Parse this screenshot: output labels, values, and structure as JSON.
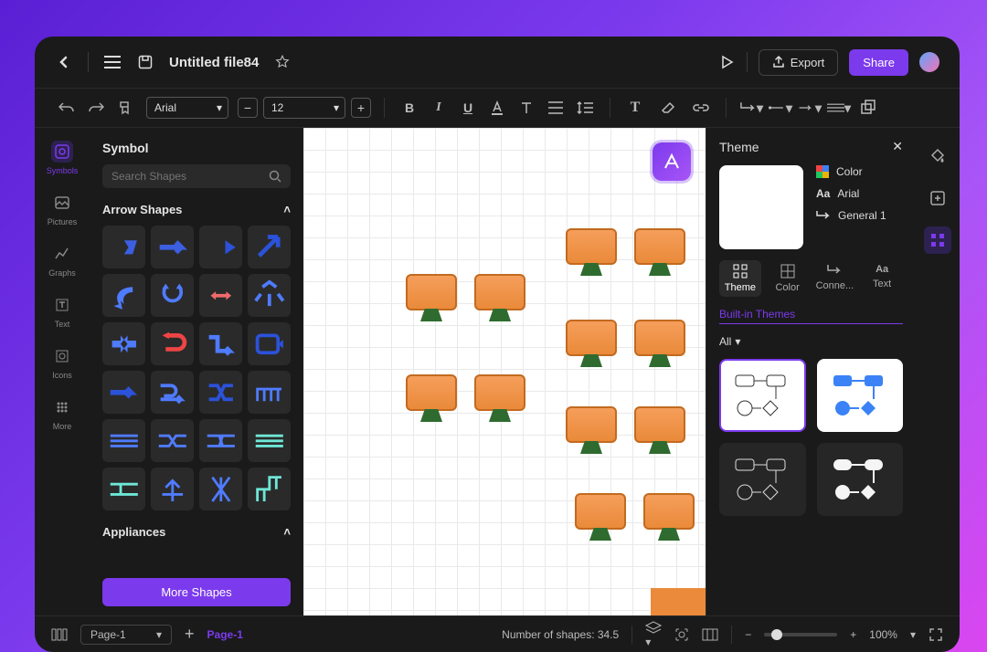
{
  "titlebar": {
    "filename": "Untitled file84",
    "play_label": "Play",
    "export_label": "Export",
    "share_label": "Share"
  },
  "toolbar": {
    "font": "Arial",
    "font_size": "12"
  },
  "left_rail": {
    "items": [
      {
        "label": "Symbols",
        "active": true
      },
      {
        "label": "Pictures"
      },
      {
        "label": "Graphs"
      },
      {
        "label": "Text"
      },
      {
        "label": "Icons"
      },
      {
        "label": "More"
      }
    ]
  },
  "left_panel": {
    "title": "Symbol",
    "search_placeholder": "Search Shapes",
    "section1": "Arrow Shapes",
    "section2": "Appliances",
    "more_label": "More Shapes"
  },
  "right_panel": {
    "title": "Theme",
    "meta_color": "Color",
    "meta_font": "Arial",
    "meta_conn": "General 1",
    "tabs": [
      "Theme",
      "Color",
      "Conne...",
      "Text"
    ],
    "builtin": "Built-in Themes",
    "filter": "All"
  },
  "statusbar": {
    "page_sel": "Page-1",
    "page_active": "Page-1",
    "shapes_label": "Number of shapes: 34.5",
    "zoom": "100%"
  }
}
